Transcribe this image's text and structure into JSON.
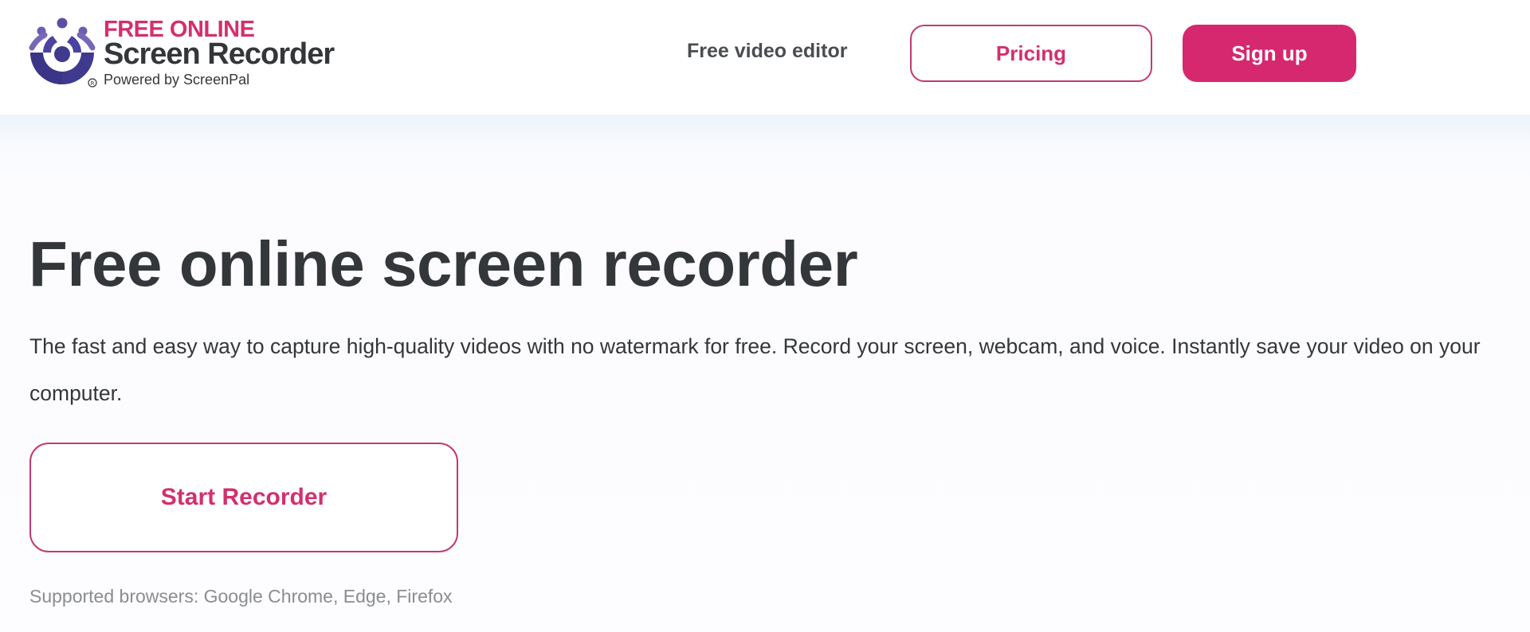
{
  "header": {
    "logo": {
      "line1": "FREE ONLINE",
      "line2": "Screen Recorder",
      "line3": "Powered by ScreenPal"
    },
    "nav_link": "Free video editor",
    "pricing_label": "Pricing",
    "signup_label": "Sign up"
  },
  "hero": {
    "title": "Free online screen recorder",
    "subtitle": "The fast and easy way to capture high-quality videos with no watermark for free. Record your screen, webcam, and voice. Instantly save your video on your computer.",
    "start_label": "Start Recorder",
    "supported": "Supported browsers: Google Chrome, Edge, Firefox"
  },
  "colors": {
    "brand_pink": "#d5286f",
    "brand_purple": "#3f3a8e",
    "text_dark": "#34373a",
    "text_muted": "#8a8d90"
  },
  "icons": {
    "logo_mark": "screenpal-logo-icon"
  }
}
